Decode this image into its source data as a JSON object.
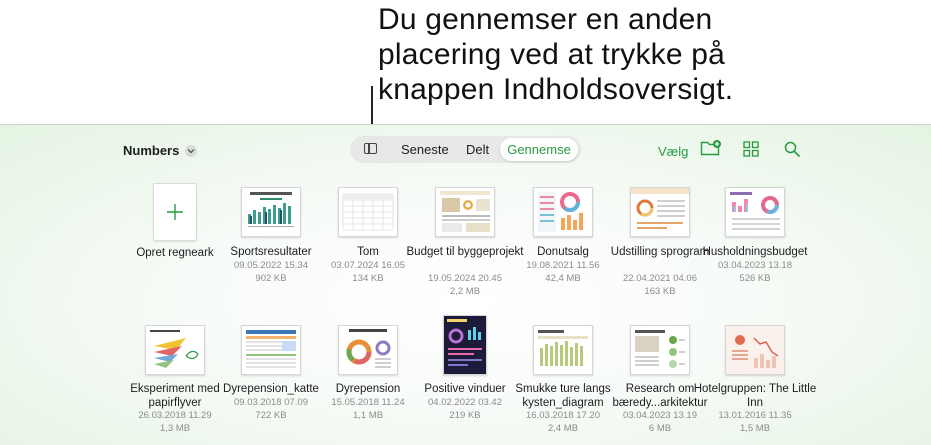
{
  "callout": {
    "line1": "Du gennemser en anden",
    "line2": "placering ved at trykke på",
    "line3": "knappen Indholdsoversigt."
  },
  "toolbar": {
    "location": "Numbers",
    "tabs": [
      "Seneste",
      "Delt",
      "Gennemse"
    ],
    "selected_tab": "Gennemse",
    "select_label": "Vælg"
  },
  "colors": {
    "accent": "#2a9a43"
  },
  "create": {
    "label": "Opret regneark"
  },
  "files": [
    {
      "name": "Sportsresultater",
      "date": "09.05.2022 15.34",
      "size": "902 KB",
      "thumb": "sports"
    },
    {
      "name": "Tom",
      "date": "03.07.2024 16.05",
      "size": "134 KB",
      "thumb": "blank"
    },
    {
      "name": "Budget til byggeprojekt",
      "date": "19.05.2024 20.45",
      "size": "2,2 MB",
      "thumb": "budget"
    },
    {
      "name": "Donutsalg",
      "date": "19.08.2021 11.56",
      "size": "42,4 MB",
      "thumb": "donut"
    },
    {
      "name": "Udstilling sprogram",
      "date": "22.04.2021 04.06",
      "size": "163 KB",
      "thumb": "exhibit"
    },
    {
      "name": "Husholdningsbudget",
      "date": "03.04.2023 13.18",
      "size": "526 KB",
      "thumb": "household"
    },
    {
      "name": "Eksperiment med papirflyver",
      "date": "26.03.2018 11.29",
      "size": "1,3 MB",
      "thumb": "plane"
    },
    {
      "name": "Dyrepension_katte",
      "date": "09.03.2018 07.09",
      "size": "722 KB",
      "thumb": "cats"
    },
    {
      "name": "Dyrepension",
      "date": "15.05.2018 11.24",
      "size": "1,1 MB",
      "thumb": "pets"
    },
    {
      "name": "Positive vinduer",
      "date": "04.02.2022 03.42",
      "size": "219 KB",
      "thumb": "windows"
    },
    {
      "name": "Smukke ture langs kysten_diagram",
      "date": "16.03.2018 17.20",
      "size": "2,4 MB",
      "thumb": "coast"
    },
    {
      "name": "Research om bæredy...arkitektur",
      "date": "03.04.2023 13.19",
      "size": "6 MB",
      "thumb": "research"
    },
    {
      "name": "Hotelgruppen: The Little Inn",
      "date": "13.01.2016 11.35",
      "size": "1,5 MB",
      "thumb": "hotel"
    }
  ]
}
